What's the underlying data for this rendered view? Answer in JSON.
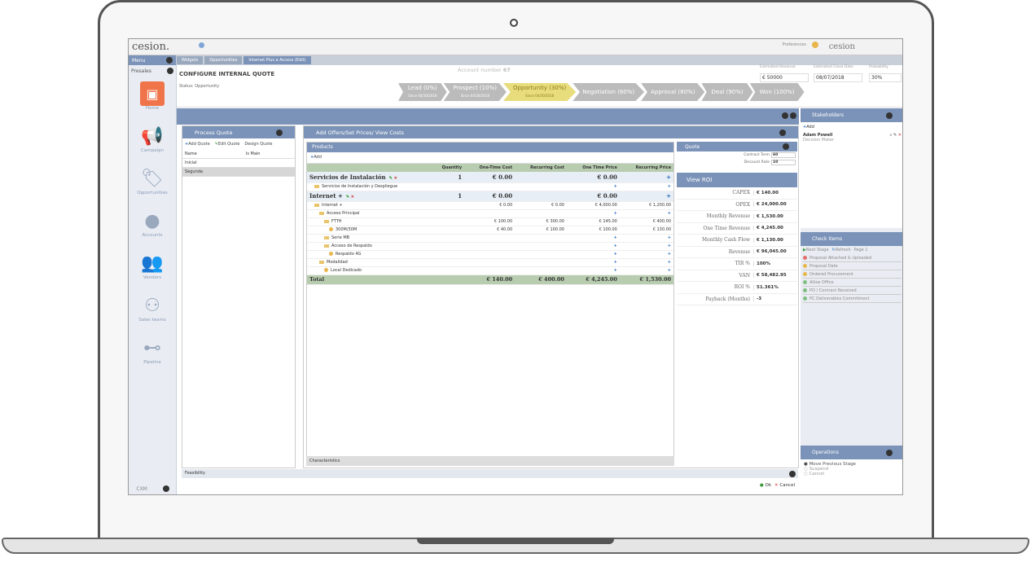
{
  "app": {
    "logo": "cesion.",
    "logo_right": "cesion",
    "preferences_label": "Preferences"
  },
  "nav": {
    "menu_label": "Menu",
    "presales_label": "Presales",
    "items": [
      {
        "label": "Home",
        "icon": "home-icon"
      },
      {
        "label": "Campaign",
        "icon": "megaphone-icon"
      },
      {
        "label": "Opportunities",
        "icon": "tag-icon"
      },
      {
        "label": "Accounts",
        "icon": "user-icon"
      },
      {
        "label": "Vendors",
        "icon": "people-icon"
      },
      {
        "label": "Sales teams",
        "icon": "org-chart-icon"
      },
      {
        "label": "Pipeline",
        "icon": "pipeline-icon"
      }
    ],
    "cxm_label": "CXM"
  },
  "tabs": [
    "Widgets",
    "Opportunities",
    "Internet Plus a Access (Edit)"
  ],
  "header": {
    "title": "CONFIGURE INTERNAL QUOTE",
    "status": "Status: Opportunity",
    "account_number_label": "Account number",
    "account_number": "67",
    "estimated_revenue_label": "Estimated Revenue",
    "estimated_revenue": "€ 50000",
    "estimated_close_label": "Estimated Close Date",
    "estimated_close": "08/07/2018",
    "probability_label": "Probability",
    "probability": "30%"
  },
  "stages": [
    {
      "label": "Lead (0%)",
      "since": "Since 04/30/2018"
    },
    {
      "label": "Prospect (10%)",
      "since": "Since 04/30/2018"
    },
    {
      "label": "Opportunity (30%)",
      "since": "Since 04/30/2018"
    },
    {
      "label": "Negotiation (60%)",
      "since": ""
    },
    {
      "label": "Approval (80%)",
      "since": ""
    },
    {
      "label": "Deal (90%)",
      "since": ""
    },
    {
      "label": "Won (100%)",
      "since": ""
    }
  ],
  "process_quote": {
    "title": "Process Quote",
    "tools": [
      "Add Quote",
      "Edit Quote",
      "Design Quote"
    ],
    "columns": [
      "Name",
      "Is Main"
    ],
    "rows": [
      "Inicial",
      "Segunda"
    ]
  },
  "offers": {
    "title": "Add Offers/Set Prices/ View Costs",
    "products_label": "Products",
    "add_label": "Add",
    "columns": [
      "Quantity",
      "One-Time Cost",
      "Recurring Cost",
      "One Time Price",
      "Recurring Price"
    ],
    "rows": [
      {
        "type": "group",
        "name": "Servicios de Instalación",
        "qty": "1",
        "otc": "€ 0.00",
        "rc": "",
        "otp": "€ 0.00",
        "rp": "+"
      },
      {
        "type": "folder",
        "indent": 1,
        "name": "Servicios de Instalación y Despliegue",
        "qty": "",
        "otc": "",
        "rc": "",
        "otp": "+",
        "rp": "+"
      },
      {
        "type": "group",
        "name": "Internet +",
        "qty": "1",
        "otc": "€ 0.00",
        "rc": "",
        "otp": "€ 0.00",
        "rp": "+"
      },
      {
        "type": "folder",
        "indent": 1,
        "name": "Internet +",
        "qty": "",
        "otc": "€ 0.00",
        "rc": "€ 0.00",
        "otp": "€ 4,000.00",
        "rp": "€ 1,200.00"
      },
      {
        "type": "folder",
        "indent": 2,
        "name": "Acceso Principal",
        "qty": "",
        "otc": "",
        "rc": "",
        "otp": "+",
        "rp": "+"
      },
      {
        "type": "folder",
        "indent": 3,
        "name": "FTTH",
        "qty": "",
        "otc": "€ 100.00",
        "rc": "€ 300.00",
        "otp": "€ 145.00",
        "rp": "€ 400.00"
      },
      {
        "type": "coin",
        "indent": 4,
        "name": "300M/30M",
        "qty": "",
        "otc": "€ 40.00",
        "rc": "€ 100.00",
        "otp": "€ 100.00",
        "rp": "€ 130.00"
      },
      {
        "type": "folder",
        "indent": 3,
        "name": "Serie MB",
        "qty": "",
        "otc": "",
        "rc": "",
        "otp": "+",
        "rp": "+"
      },
      {
        "type": "folder",
        "indent": 3,
        "name": "Acceso de Respaldo",
        "qty": "",
        "otc": "",
        "rc": "",
        "otp": "+",
        "rp": "+"
      },
      {
        "type": "coin",
        "indent": 4,
        "name": "Respaldo 4G",
        "qty": "",
        "otc": "",
        "rc": "",
        "otp": "+",
        "rp": "+"
      },
      {
        "type": "folder",
        "indent": 2,
        "name": "Modalidad",
        "qty": "",
        "otc": "",
        "rc": "",
        "otp": "+",
        "rp": "+"
      },
      {
        "type": "coin",
        "indent": 3,
        "name": "Local Dedicado",
        "qty": "",
        "otc": "",
        "rc": "",
        "otp": "+",
        "rp": "+"
      }
    ],
    "total": {
      "name": "Total",
      "otc": "€ 140.00",
      "rc": "€ 400.00",
      "otp": "€ 4,245.00",
      "rp": "€ 1,530.00"
    },
    "characteristics_label": "Characteristics"
  },
  "quote": {
    "title": "Quote",
    "contract_term_label": "Contract Term",
    "contract_term": "60",
    "discount_rate_label": "Discount Rate",
    "discount_rate": "10"
  },
  "roi": {
    "title": "View ROI",
    "rows": [
      {
        "label": "CAPEX",
        "value": "€ 140.00"
      },
      {
        "label": "OPEX",
        "value": "€ 24,000.00"
      },
      {
        "label": "Monthly Revenue",
        "value": "€ 1,530.00"
      },
      {
        "label": "One Time Revenue",
        "value": "€ 4,245.00"
      },
      {
        "label": "Monthly Cash Flow",
        "value": "€ 1,130.00"
      },
      {
        "label": "Revenue",
        "value": "€ 96,045.00"
      },
      {
        "label": "TIR %",
        "value": "100%"
      },
      {
        "label": "VAN",
        "value": "€ 58,482.95"
      },
      {
        "label": "ROI %",
        "value": "51.361%"
      },
      {
        "label": "Payback (Months)",
        "value": "-3"
      }
    ]
  },
  "feasibility_label": "Feasibility",
  "ok_label": "Ok",
  "cancel_label": "Cancel",
  "stakeholders": {
    "title": "Stakeholders",
    "add_label": "Add",
    "person_name": "Adam Powell",
    "person_role": "Decision Maker"
  },
  "check_items": {
    "title": "Check Items",
    "next_stage": "Next Stage",
    "refresh": "Refresh",
    "page": "Page 1",
    "items": [
      {
        "label": "Proposal Attached & Uploaded",
        "color": "#e07070"
      },
      {
        "label": "Proposal Date",
        "color": "#e9b64d"
      },
      {
        "label": "Ordered Procurement",
        "color": "#e9b64d"
      },
      {
        "label": "Allow Office",
        "color": "#7fbf7f"
      },
      {
        "label": "PO / Contract Received",
        "color": "#7fbf7f"
      },
      {
        "label": "PC Deliverables Commitment",
        "color": "#7fbf7f"
      }
    ]
  },
  "operations": {
    "title": "Operations",
    "items": [
      "Move Previous Stage",
      "Suspend",
      "Cancel"
    ]
  }
}
